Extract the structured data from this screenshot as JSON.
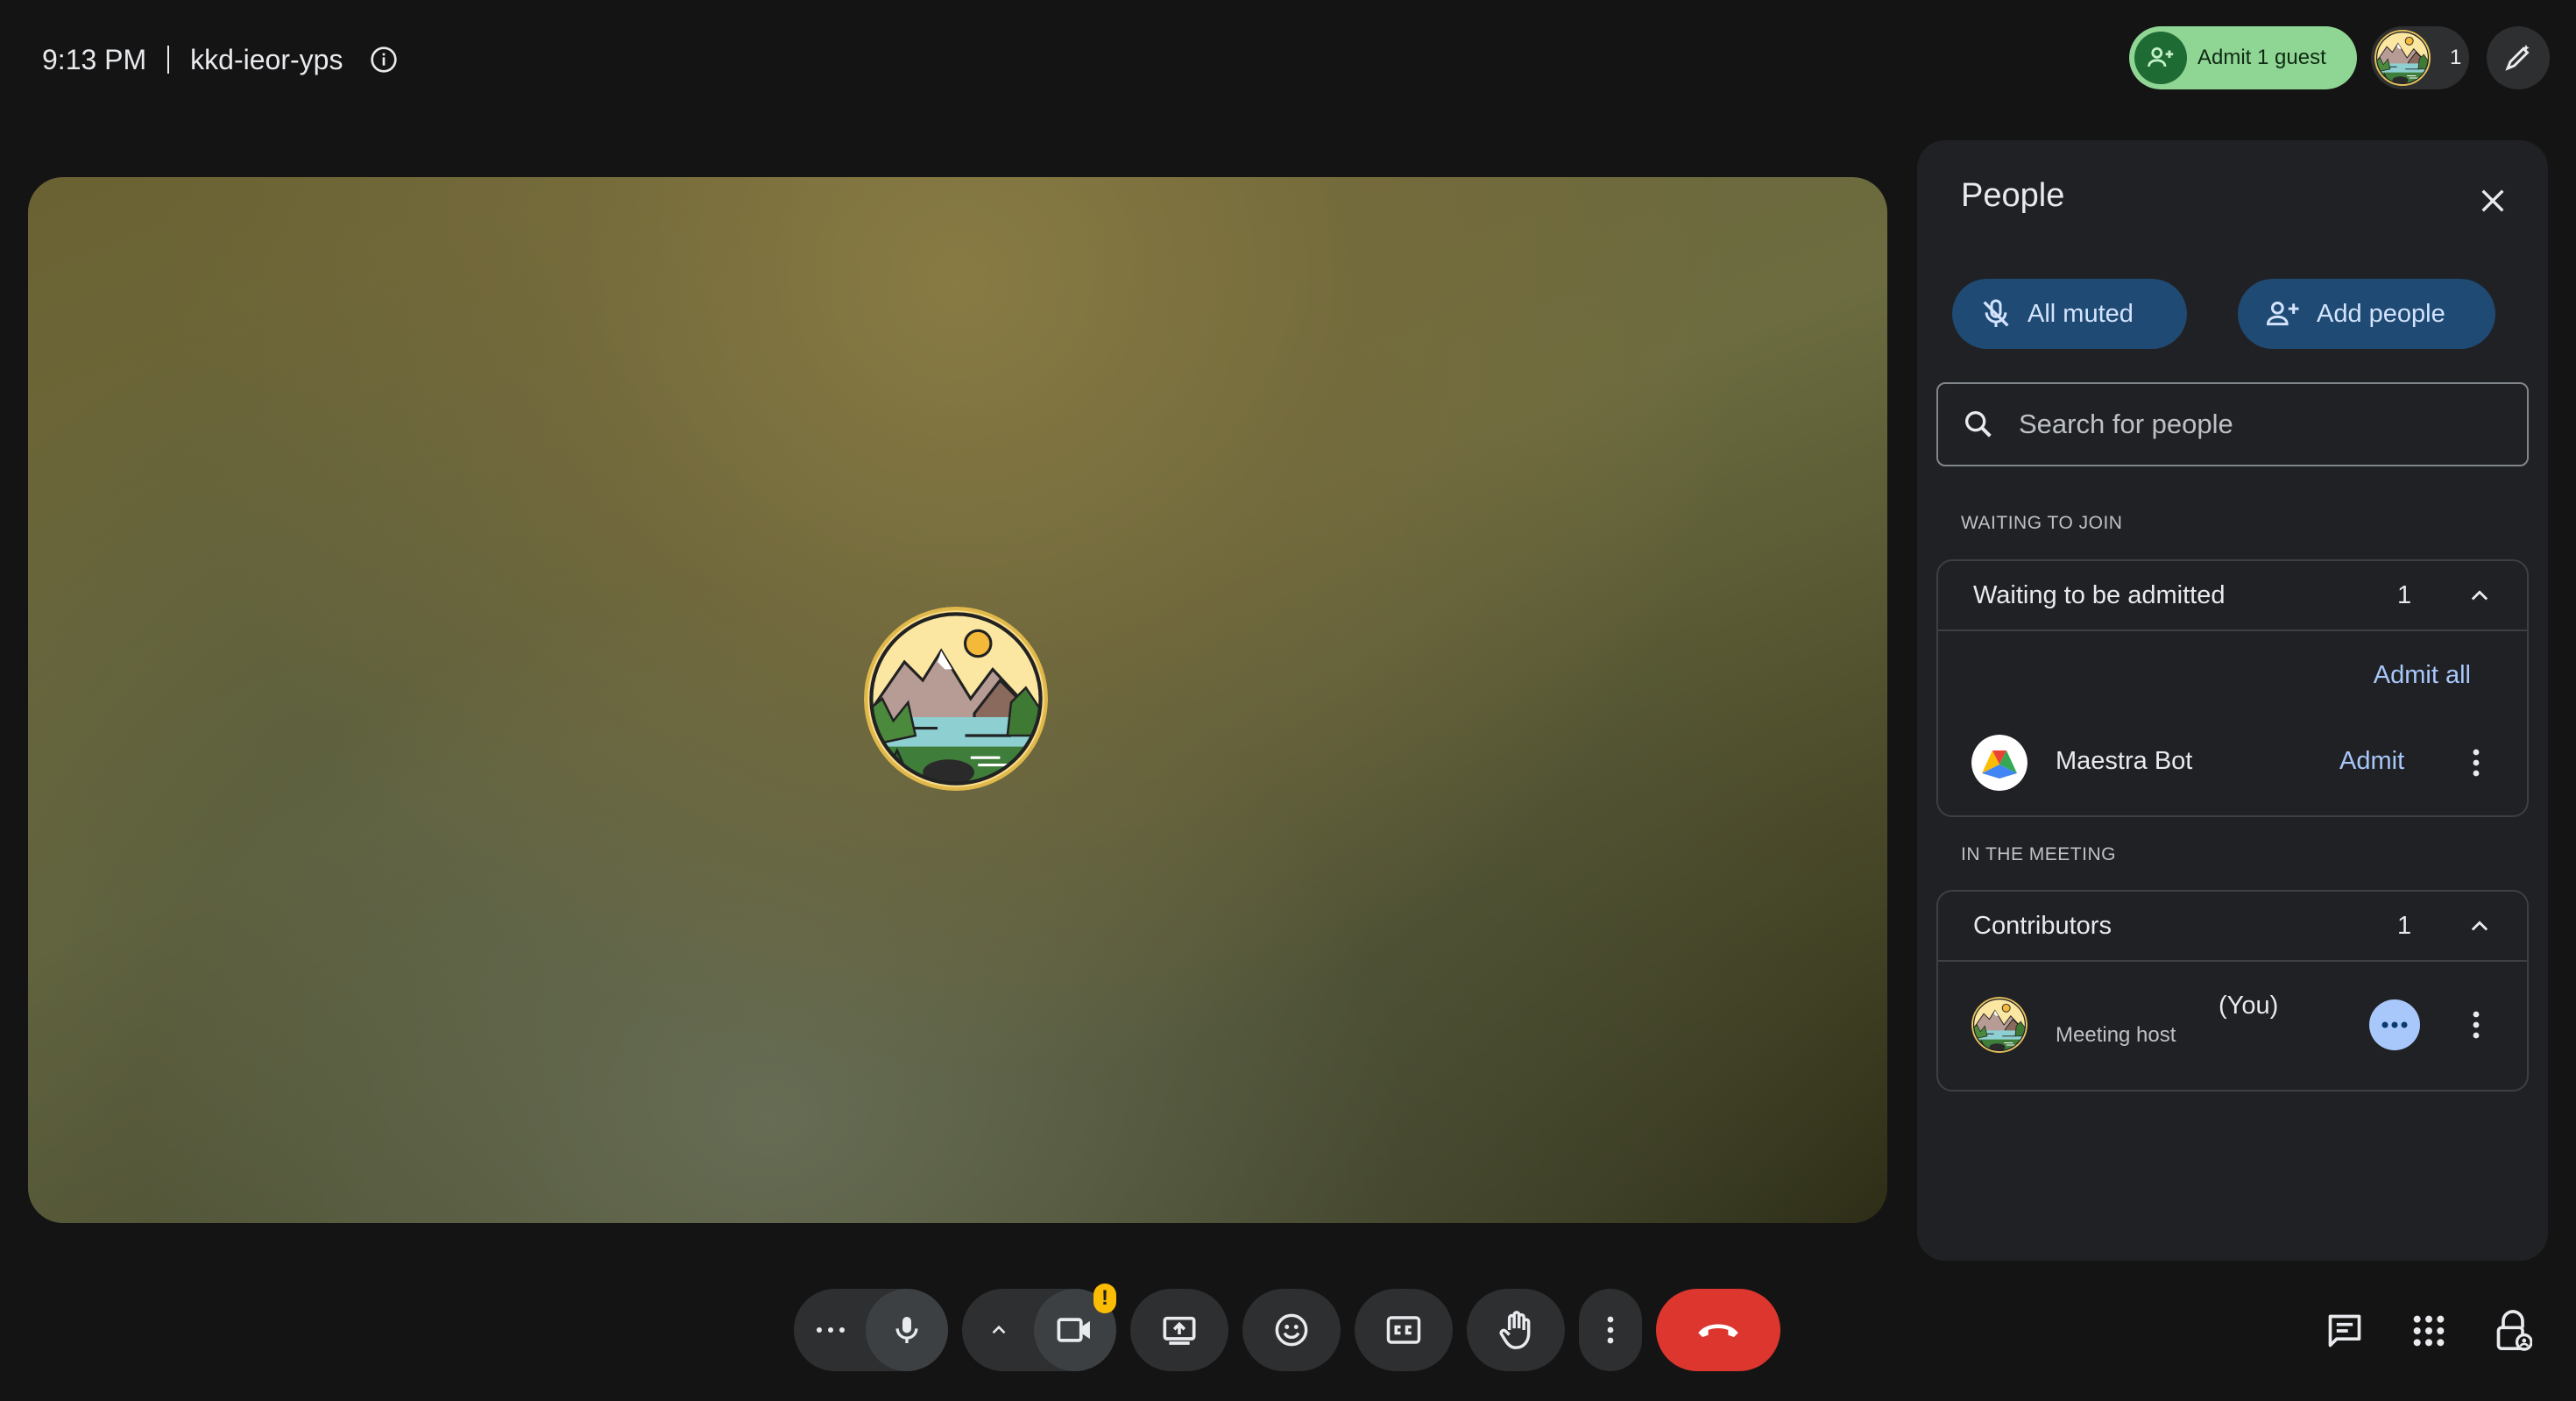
{
  "meeting": {
    "time": "9:13 PM",
    "code": "kkd-ieor-yps"
  },
  "top_right": {
    "admit_label": "Admit 1 guest",
    "participant_count": "1"
  },
  "people_panel": {
    "title": "People",
    "all_muted_label": "All muted",
    "add_people_label": "Add people",
    "search_placeholder": "Search for people",
    "waiting_section_label": "WAITING TO JOIN",
    "waiting_group": {
      "title": "Waiting to be admitted",
      "count": "1",
      "admit_all_label": "Admit all",
      "person": {
        "name": "Maestra Bot",
        "admit_label": "Admit"
      }
    },
    "in_meeting_section_label": "IN THE MEETING",
    "contributors_group": {
      "title": "Contributors",
      "count": "1",
      "person": {
        "you_label": "(You)",
        "role": "Meeting host"
      }
    }
  },
  "colors": {
    "admit_pill": "#8fd694",
    "blue_button": "#1f4a73",
    "link": "#a8c7fa",
    "end_call": "#dc362e",
    "warning": "#fbbc04"
  },
  "icons": {
    "info": "info-icon",
    "admit": "person-add-icon",
    "edit": "pen-sparkle-icon",
    "close": "close-icon",
    "mic_off": "mic-off-icon",
    "search": "search-icon",
    "chevron": "chevron-up-icon",
    "more": "more-vert-icon",
    "mic": "mic-icon",
    "camera": "videocam-icon",
    "present": "present-screen-icon",
    "emoji": "emoji-icon",
    "captions": "captions-icon",
    "hand": "raise-hand-icon",
    "end": "call-end-icon",
    "chat": "chat-icon",
    "apps": "apps-grid-icon",
    "host_controls": "lock-person-icon"
  },
  "bottom_bar": {
    "camera_warning": "!"
  }
}
